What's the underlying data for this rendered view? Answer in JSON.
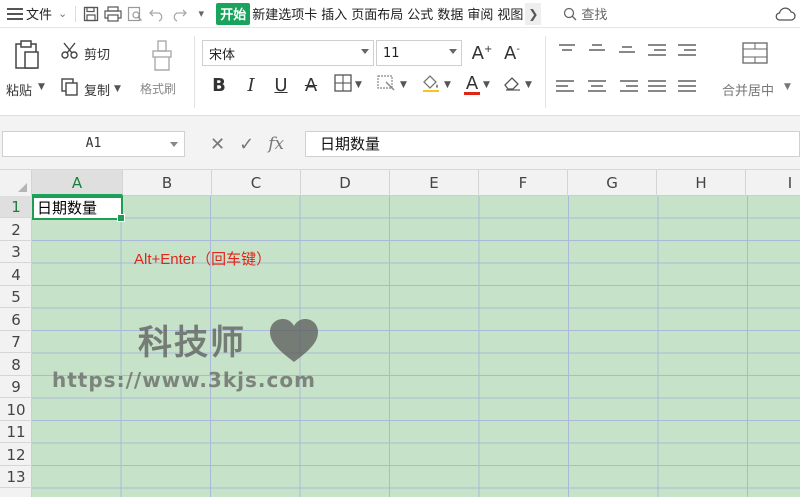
{
  "menu": {
    "file": "文件",
    "tabs": [
      "开始",
      "新建选项卡",
      "插入",
      "页面布局",
      "公式",
      "数据",
      "审阅",
      "视图"
    ],
    "search": "查找"
  },
  "ribbon": {
    "paste": "粘贴",
    "cut": "剪切",
    "copy": "复制",
    "format_painter": "格式刷",
    "font_name": "宋体",
    "font_size": "11",
    "merge_center": "合并居中"
  },
  "formula_bar": {
    "cell_ref": "A1",
    "formula": "日期数量"
  },
  "grid": {
    "columns": [
      "A",
      "B",
      "C",
      "D",
      "E",
      "F",
      "G",
      "H",
      "I"
    ],
    "rows": [
      "1",
      "2",
      "3",
      "4",
      "5",
      "6",
      "7",
      "8",
      "9",
      "10",
      "11",
      "12",
      "13"
    ],
    "a1_value": "日期数量",
    "annotation": "Alt+Enter（回车键）"
  },
  "watermark": {
    "title": "科技师",
    "url": "https://www.3kjs.com"
  },
  "colors": {
    "accent": "#1aa35c",
    "sheet_bg": "#c6e2c8",
    "annotation": "#e0261b"
  }
}
